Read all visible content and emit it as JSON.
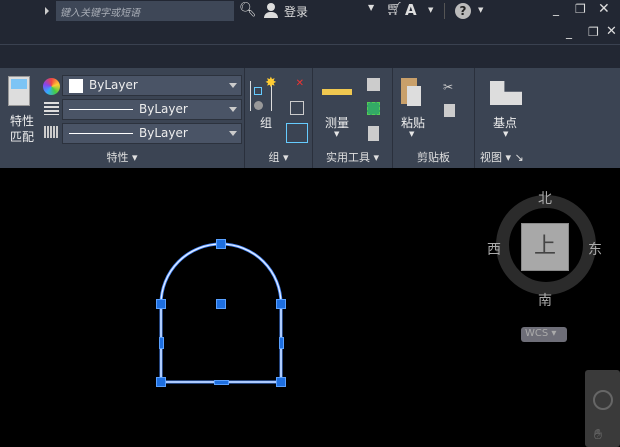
{
  "titlebar": {
    "search_placeholder": "键入关键字或短语",
    "login": "登录"
  },
  "ribbon": {
    "properties": {
      "match_label_1": "特性",
      "match_label_2": "匹配",
      "color": "ByLayer",
      "linetype": "ByLayer",
      "lineweight": "ByLayer",
      "title": "特性"
    },
    "group": {
      "group_label": "组",
      "title": "组"
    },
    "utilities": {
      "measure_label": "测量",
      "title": "实用工具"
    },
    "clipboard": {
      "paste_label": "粘贴",
      "title": "剪贴板"
    },
    "view": {
      "basepoint_label": "基点",
      "title": "视图"
    }
  },
  "viewcube": {
    "north": "北",
    "south": "南",
    "east": "东",
    "west": "西",
    "face": "上",
    "wcs": "WCS"
  },
  "colors": {
    "accent": "#1e6fe0",
    "ribbon": "#3b4453",
    "titlebar": "#222733"
  }
}
